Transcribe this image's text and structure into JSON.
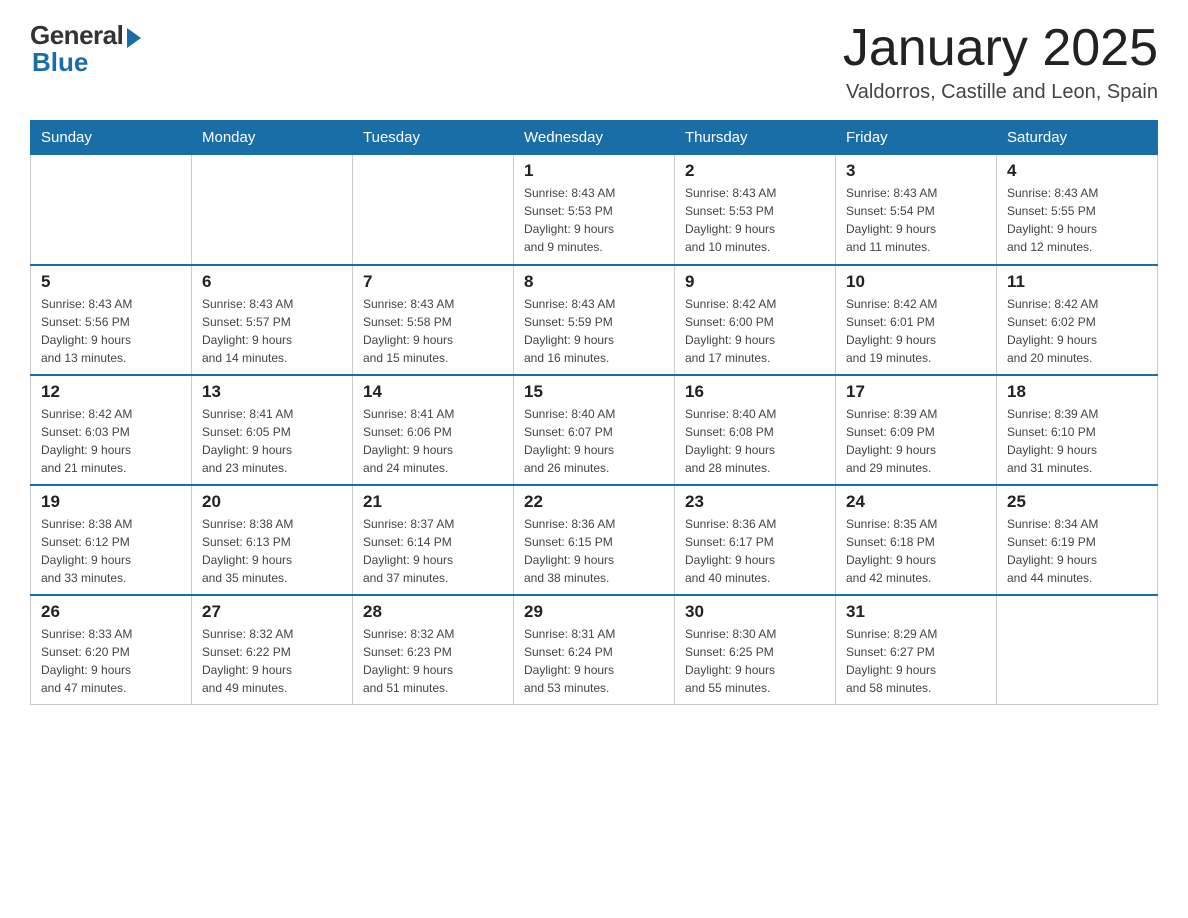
{
  "logo": {
    "general": "General",
    "blue": "Blue"
  },
  "header": {
    "title": "January 2025",
    "subtitle": "Valdorros, Castille and Leon, Spain"
  },
  "days": [
    "Sunday",
    "Monday",
    "Tuesday",
    "Wednesday",
    "Thursday",
    "Friday",
    "Saturday"
  ],
  "weeks": [
    [
      {
        "day": "",
        "info": ""
      },
      {
        "day": "",
        "info": ""
      },
      {
        "day": "",
        "info": ""
      },
      {
        "day": "1",
        "info": "Sunrise: 8:43 AM\nSunset: 5:53 PM\nDaylight: 9 hours\nand 9 minutes."
      },
      {
        "day": "2",
        "info": "Sunrise: 8:43 AM\nSunset: 5:53 PM\nDaylight: 9 hours\nand 10 minutes."
      },
      {
        "day": "3",
        "info": "Sunrise: 8:43 AM\nSunset: 5:54 PM\nDaylight: 9 hours\nand 11 minutes."
      },
      {
        "day": "4",
        "info": "Sunrise: 8:43 AM\nSunset: 5:55 PM\nDaylight: 9 hours\nand 12 minutes."
      }
    ],
    [
      {
        "day": "5",
        "info": "Sunrise: 8:43 AM\nSunset: 5:56 PM\nDaylight: 9 hours\nand 13 minutes."
      },
      {
        "day": "6",
        "info": "Sunrise: 8:43 AM\nSunset: 5:57 PM\nDaylight: 9 hours\nand 14 minutes."
      },
      {
        "day": "7",
        "info": "Sunrise: 8:43 AM\nSunset: 5:58 PM\nDaylight: 9 hours\nand 15 minutes."
      },
      {
        "day": "8",
        "info": "Sunrise: 8:43 AM\nSunset: 5:59 PM\nDaylight: 9 hours\nand 16 minutes."
      },
      {
        "day": "9",
        "info": "Sunrise: 8:42 AM\nSunset: 6:00 PM\nDaylight: 9 hours\nand 17 minutes."
      },
      {
        "day": "10",
        "info": "Sunrise: 8:42 AM\nSunset: 6:01 PM\nDaylight: 9 hours\nand 19 minutes."
      },
      {
        "day": "11",
        "info": "Sunrise: 8:42 AM\nSunset: 6:02 PM\nDaylight: 9 hours\nand 20 minutes."
      }
    ],
    [
      {
        "day": "12",
        "info": "Sunrise: 8:42 AM\nSunset: 6:03 PM\nDaylight: 9 hours\nand 21 minutes."
      },
      {
        "day": "13",
        "info": "Sunrise: 8:41 AM\nSunset: 6:05 PM\nDaylight: 9 hours\nand 23 minutes."
      },
      {
        "day": "14",
        "info": "Sunrise: 8:41 AM\nSunset: 6:06 PM\nDaylight: 9 hours\nand 24 minutes."
      },
      {
        "day": "15",
        "info": "Sunrise: 8:40 AM\nSunset: 6:07 PM\nDaylight: 9 hours\nand 26 minutes."
      },
      {
        "day": "16",
        "info": "Sunrise: 8:40 AM\nSunset: 6:08 PM\nDaylight: 9 hours\nand 28 minutes."
      },
      {
        "day": "17",
        "info": "Sunrise: 8:39 AM\nSunset: 6:09 PM\nDaylight: 9 hours\nand 29 minutes."
      },
      {
        "day": "18",
        "info": "Sunrise: 8:39 AM\nSunset: 6:10 PM\nDaylight: 9 hours\nand 31 minutes."
      }
    ],
    [
      {
        "day": "19",
        "info": "Sunrise: 8:38 AM\nSunset: 6:12 PM\nDaylight: 9 hours\nand 33 minutes."
      },
      {
        "day": "20",
        "info": "Sunrise: 8:38 AM\nSunset: 6:13 PM\nDaylight: 9 hours\nand 35 minutes."
      },
      {
        "day": "21",
        "info": "Sunrise: 8:37 AM\nSunset: 6:14 PM\nDaylight: 9 hours\nand 37 minutes."
      },
      {
        "day": "22",
        "info": "Sunrise: 8:36 AM\nSunset: 6:15 PM\nDaylight: 9 hours\nand 38 minutes."
      },
      {
        "day": "23",
        "info": "Sunrise: 8:36 AM\nSunset: 6:17 PM\nDaylight: 9 hours\nand 40 minutes."
      },
      {
        "day": "24",
        "info": "Sunrise: 8:35 AM\nSunset: 6:18 PM\nDaylight: 9 hours\nand 42 minutes."
      },
      {
        "day": "25",
        "info": "Sunrise: 8:34 AM\nSunset: 6:19 PM\nDaylight: 9 hours\nand 44 minutes."
      }
    ],
    [
      {
        "day": "26",
        "info": "Sunrise: 8:33 AM\nSunset: 6:20 PM\nDaylight: 9 hours\nand 47 minutes."
      },
      {
        "day": "27",
        "info": "Sunrise: 8:32 AM\nSunset: 6:22 PM\nDaylight: 9 hours\nand 49 minutes."
      },
      {
        "day": "28",
        "info": "Sunrise: 8:32 AM\nSunset: 6:23 PM\nDaylight: 9 hours\nand 51 minutes."
      },
      {
        "day": "29",
        "info": "Sunrise: 8:31 AM\nSunset: 6:24 PM\nDaylight: 9 hours\nand 53 minutes."
      },
      {
        "day": "30",
        "info": "Sunrise: 8:30 AM\nSunset: 6:25 PM\nDaylight: 9 hours\nand 55 minutes."
      },
      {
        "day": "31",
        "info": "Sunrise: 8:29 AM\nSunset: 6:27 PM\nDaylight: 9 hours\nand 58 minutes."
      },
      {
        "day": "",
        "info": ""
      }
    ]
  ]
}
